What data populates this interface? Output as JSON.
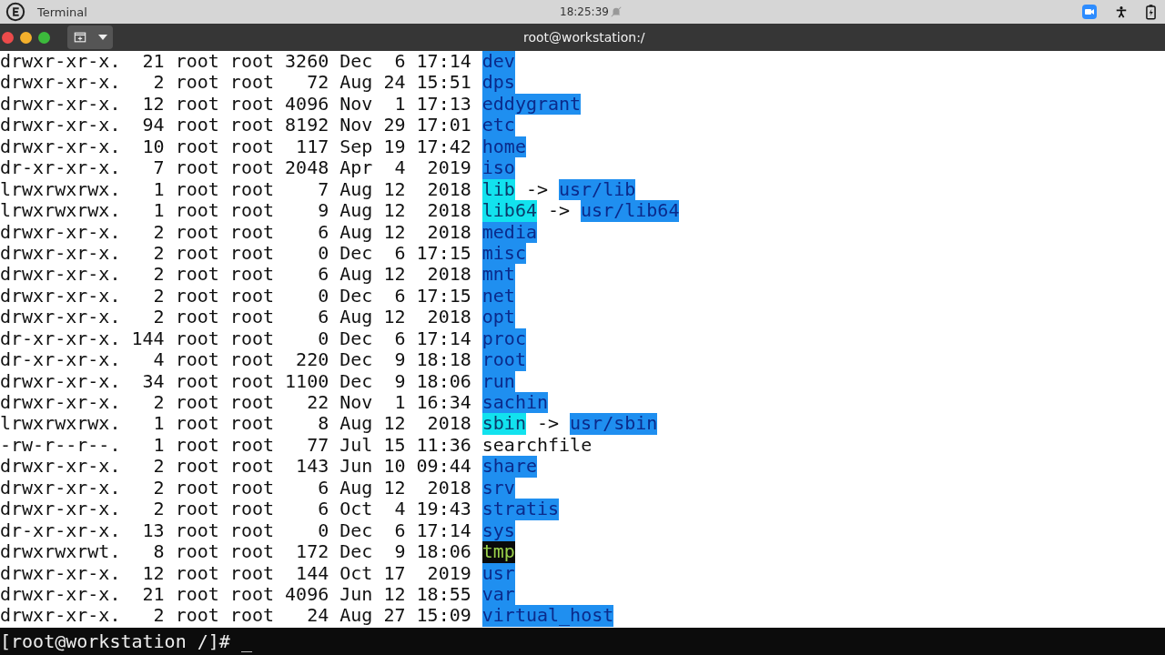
{
  "top_bar": {
    "app_name": "Terminal",
    "clock": "18:25:39"
  },
  "window": {
    "title": "root@workstation:/"
  },
  "listing": [
    {
      "info": "drwxr-xr-x.  21 root root 3260 Dec  6 17:14",
      "name": "dev",
      "kind": "dir"
    },
    {
      "info": "drwxr-xr-x.   2 root root   72 Aug 24 15:51",
      "name": "dps",
      "kind": "dir"
    },
    {
      "info": "drwxr-xr-x.  12 root root 4096 Nov  1 17:13",
      "name": "eddygrant",
      "kind": "dir"
    },
    {
      "info": "drwxr-xr-x.  94 root root 8192 Nov 29 17:01",
      "name": "etc",
      "kind": "dir"
    },
    {
      "info": "drwxr-xr-x.  10 root root  117 Sep 19 17:42",
      "name": "home",
      "kind": "dir"
    },
    {
      "info": "dr-xr-xr-x.   7 root root 2048 Apr  4  2019",
      "name": "iso",
      "kind": "dir"
    },
    {
      "info": "lrwxrwxrwx.   1 root root    7 Aug 12  2018",
      "name": "lib",
      "kind": "link",
      "arrow": "->",
      "target": "usr/lib"
    },
    {
      "info": "lrwxrwxrwx.   1 root root    9 Aug 12  2018",
      "name": "lib64",
      "kind": "link",
      "arrow": "->",
      "target": "usr/lib64"
    },
    {
      "info": "drwxr-xr-x.   2 root root    6 Aug 12  2018",
      "name": "media",
      "kind": "dir"
    },
    {
      "info": "drwxr-xr-x.   2 root root    0 Dec  6 17:15",
      "name": "misc",
      "kind": "dir"
    },
    {
      "info": "drwxr-xr-x.   2 root root    6 Aug 12  2018",
      "name": "mnt",
      "kind": "dir"
    },
    {
      "info": "drwxr-xr-x.   2 root root    0 Dec  6 17:15",
      "name": "net",
      "kind": "dir"
    },
    {
      "info": "drwxr-xr-x.   2 root root    6 Aug 12  2018",
      "name": "opt",
      "kind": "dir"
    },
    {
      "info": "dr-xr-xr-x. 144 root root    0 Dec  6 17:14",
      "name": "proc",
      "kind": "dir"
    },
    {
      "info": "dr-xr-xr-x.   4 root root  220 Dec  9 18:18",
      "name": "root",
      "kind": "dir"
    },
    {
      "info": "drwxr-xr-x.  34 root root 1100 Dec  9 18:06",
      "name": "run",
      "kind": "dir"
    },
    {
      "info": "drwxr-xr-x.   2 root root   22 Nov  1 16:34",
      "name": "sachin",
      "kind": "dir"
    },
    {
      "info": "lrwxrwxrwx.   1 root root    8 Aug 12  2018",
      "name": "sbin",
      "kind": "link",
      "arrow": "->",
      "target": "usr/sbin"
    },
    {
      "info": "-rw-r--r--.   1 root root   77 Jul 15 11:36",
      "name": "searchfile",
      "kind": "file"
    },
    {
      "info": "drwxr-xr-x.   2 root root  143 Jun 10 09:44",
      "name": "share",
      "kind": "dir"
    },
    {
      "info": "drwxr-xr-x.   2 root root    6 Aug 12  2018",
      "name": "srv",
      "kind": "dir"
    },
    {
      "info": "drwxr-xr-x.   2 root root    6 Oct  4 19:43",
      "name": "stratis",
      "kind": "dir"
    },
    {
      "info": "dr-xr-xr-x.  13 root root    0 Dec  6 17:14",
      "name": "sys",
      "kind": "dir"
    },
    {
      "info": "drwxrwxrwt.   8 root root  172 Dec  9 18:06",
      "name": "tmp",
      "kind": "sticky"
    },
    {
      "info": "drwxr-xr-x.  12 root root  144 Oct 17  2019",
      "name": "usr",
      "kind": "dir"
    },
    {
      "info": "drwxr-xr-x.  21 root root 4096 Jun 12 18:55",
      "name": "var",
      "kind": "dir"
    },
    {
      "info": "drwxr-xr-x.   2 root root   24 Aug 27 15:09",
      "name": "virtual_host",
      "kind": "dir"
    }
  ],
  "prompt": {
    "text": "[root@workstation /]#",
    "cursor": "_"
  }
}
